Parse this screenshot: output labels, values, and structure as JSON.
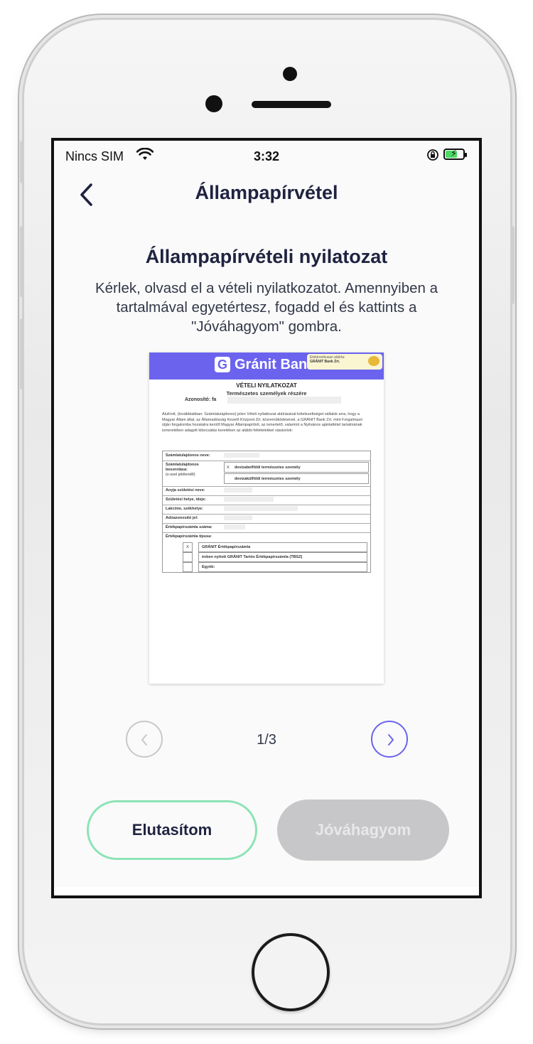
{
  "status_bar": {
    "carrier": "Nincs SIM",
    "time": "3:32",
    "wifi_icon": "wifi-icon",
    "lock_icon": "orientation-lock-icon",
    "battery_icon": "battery-charging-icon"
  },
  "nav": {
    "title": "Állampapírvétel",
    "back_icon": "chevron-left-icon"
  },
  "content": {
    "heading": "Állampapírvételi nyilatozat",
    "description": "Kérlek, olvasd el a vételi nyilatkozatot. Amennyiben a tartalmával egyetértesz, fogadd el és kattints a \"Jóváhagyom\" gombra."
  },
  "document": {
    "brand": "Gránit Bank",
    "stamp_line1": "Elektronikusan aláírta:",
    "stamp_line2": "GRÁNIT Bank Zrt.",
    "title": "VÉTELI NYILATKOZAT",
    "subtitle": "Természetes személyek részére",
    "id_label": "Azonosító: fa",
    "paragraph": "Alulírott, (továbbiakban: Számlatulajdonos) jelen Vételi nyilatkozat aláírásával kötelezettséget vállalok arra, hogy a Magyar Állam által, az Államadósság Kezelő Központ Zrt. közreműködésével, a GRÁNIT Bank Zrt. mint Forgalmazó útján forgalomba hozatalra kerülő Magyar Állampapírból, az ismertető, valamint a Nyilvános ajánlattétel tartalmának ismeretében adagolt kibocsátás keretében az alábbi feltételekkel vásárolok:",
    "rows": {
      "owner_name": "Számlatulajdonos neve:",
      "owner_class": "Számlatulajdonos besorolása:",
      "owner_class_hint": "(x-szel jelölendő)",
      "opt_resident": "devizabelföldi természetes személy",
      "opt_nonresident": "devizakülföldi természetes személy",
      "mother_name": "Anyja születési neve:",
      "birth": "Születési helye, ideje:",
      "address": "Lakcíme, székhelye:",
      "tax_id": "Adóazonosító jel:",
      "account_no": "Értékpapírszámla száma:",
      "account_type": "Értékpapírszámla típusa:",
      "type_granit": "GRÁNIT Értékpapírszámla",
      "type_tbsz": "évben nyitott GRÁNIT Tartós Értékpapírszámla (TBSZ)",
      "type_other": "Egyéb:",
      "mark": "X"
    }
  },
  "pager": {
    "text": "1/3",
    "prev_icon": "chevron-left-icon",
    "next_icon": "chevron-right-icon"
  },
  "buttons": {
    "reject": "Elutasítom",
    "accept": "Jóváhagyom"
  },
  "colors": {
    "accent": "#6b63ee",
    "reject_border": "#8ee3b6",
    "disabled_button": "#c7c7c9",
    "text_dark": "#1f2340"
  }
}
